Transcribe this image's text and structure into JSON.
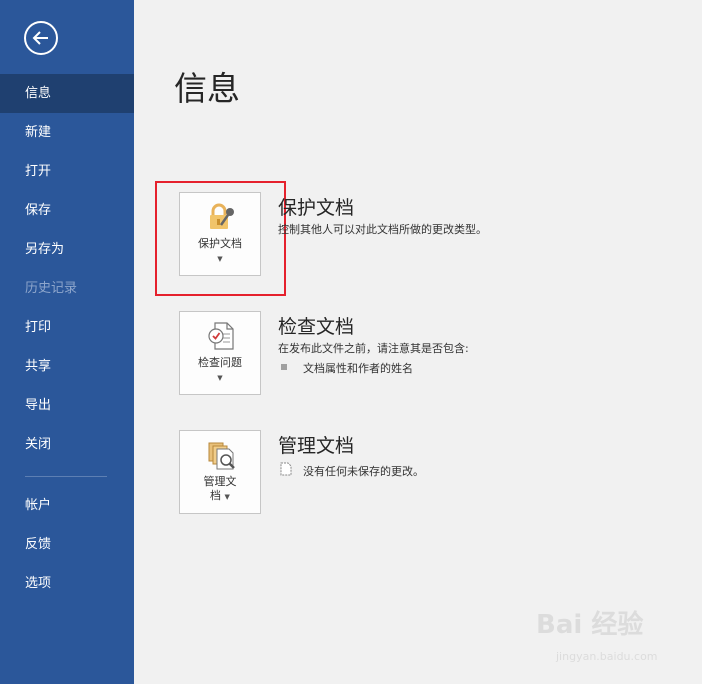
{
  "sidebar": {
    "back_icon": "back-arrow-icon",
    "items": [
      {
        "label": "信息",
        "state": "active"
      },
      {
        "label": "新建",
        "state": "normal"
      },
      {
        "label": "打开",
        "state": "normal"
      },
      {
        "label": "保存",
        "state": "normal"
      },
      {
        "label": "另存为",
        "state": "normal"
      },
      {
        "label": "历史记录",
        "state": "disabled"
      },
      {
        "label": "打印",
        "state": "normal"
      },
      {
        "label": "共享",
        "state": "normal"
      },
      {
        "label": "导出",
        "state": "normal"
      },
      {
        "label": "关闭",
        "state": "normal"
      },
      {
        "label": "帐户",
        "state": "normal"
      },
      {
        "label": "反馈",
        "state": "normal"
      },
      {
        "label": "选项",
        "state": "normal"
      }
    ]
  },
  "main": {
    "title": "信息",
    "sections": [
      {
        "tile_label": "保护文档",
        "tile_icon": "lock-key-icon",
        "title": "保护文档",
        "desc": "控制其他人可以对此文档所做的更改类型。"
      },
      {
        "tile_label": "检查问题",
        "tile_icon": "inspect-document-icon",
        "title": "检查文档",
        "desc": "在发布此文件之前，请注意其是否包含:",
        "bullets": [
          "文档属性和作者的姓名"
        ]
      },
      {
        "tile_label_line1": "管理文",
        "tile_label_line2": "档",
        "tile_icon": "manage-document-icon",
        "title": "管理文档",
        "desc": "没有任何未保存的更改。"
      }
    ]
  },
  "watermark": {
    "text": "Bai 经验",
    "sub": "jingyan.baidu.com"
  },
  "colors": {
    "sidebar": "#2b579a",
    "sidebar_active": "#1f4070",
    "highlight": "#e5212d",
    "background": "#f1f1f1"
  }
}
